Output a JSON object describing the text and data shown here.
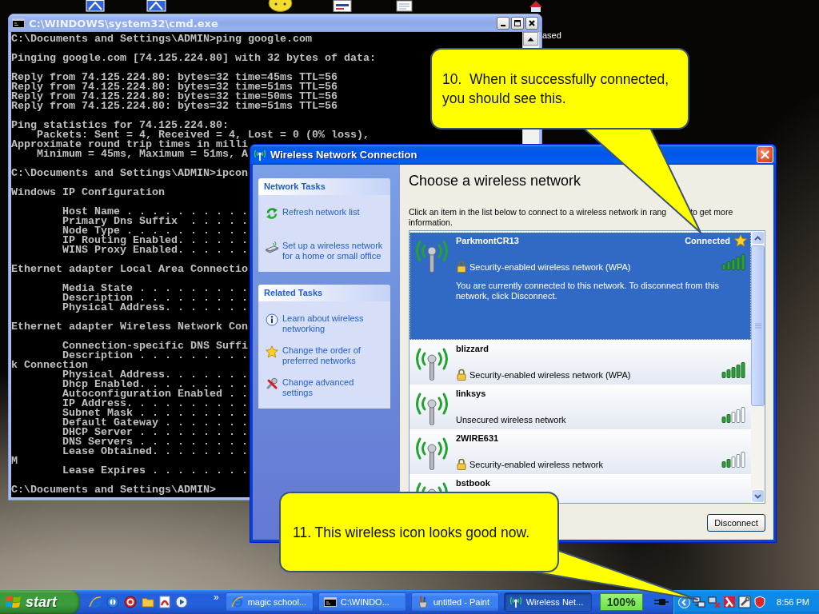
{
  "desktop": {
    "icon_label": "ased"
  },
  "cmd_window": {
    "title": "C:\\WINDOWS\\system32\\cmd.exe",
    "active": false,
    "blocks": [
      [
        "C:\\Documents and Settings\\ADMIN>ping google.com"
      ],
      [
        "Pinging google.com [74.125.224.80] with 32 bytes of data:"
      ],
      [
        "Reply from 74.125.224.80: bytes=32 time=45ms TTL=56",
        "Reply from 74.125.224.80: bytes=32 time=51ms TTL=56",
        "Reply from 74.125.224.80: bytes=32 time=50ms TTL=56",
        "Reply from 74.125.224.80: bytes=32 time=51ms TTL=56"
      ],
      [
        "Ping statistics for 74.125.224.80:",
        "    Packets: Sent = 4, Received = 4, Lost = 0 (0% loss),",
        "Approximate round trip times in milli",
        "    Minimum = 45ms, Maximum = 51ms, A"
      ],
      [
        "C:\\Documents and Settings\\ADMIN>ipcon"
      ],
      [
        "Windows IP Configuration"
      ],
      [
        "        Host Name . . . . . . . . . .",
        "        Primary Dns Suffix  . . . . .",
        "        Node Type . . . . . . . . . .",
        "        IP Routing Enabled. . . . . .",
        "        WINS Proxy Enabled. . . . . ."
      ],
      [
        "Ethernet adapter Local Area Connectio"
      ],
      [
        "        Media State . . . . . . . . .",
        "        Description . . . . . . . . .",
        "        Physical Address. . . . . . ."
      ],
      [
        "Ethernet adapter Wireless Network Con"
      ],
      [
        "        Connection-specific DNS Suffi",
        "        Description . . . . . . . . .",
        "k Connection",
        "        Physical Address. . . . . . .",
        "        Dhcp Enabled. . . . . . . . .",
        "        Autoconfiguration Enabled . .",
        "        IP Address. . . . . . . . . .",
        "        Subnet Mask . . . . . . . . .",
        "        Default Gateway . . . . . . .",
        "        DHCP Server . . . . . . . . .",
        "        DNS Servers . . . . . . . . .",
        "        Lease Obtained. . . . . . . .",
        "M",
        "        Lease Expires . . . . . . . ."
      ],
      [
        "C:\\Documents and Settings\\ADMIN>"
      ]
    ]
  },
  "wireless_dialog": {
    "title": "Wireless Network Connection",
    "active": true,
    "task_groups": [
      {
        "title": "Network Tasks",
        "items": [
          "Refresh network list",
          "Set up a wireless network for a home or small office"
        ]
      },
      {
        "title": "Related Tasks",
        "items": [
          "Learn about wireless networking",
          "Change the order of preferred networks",
          "Change advanced settings"
        ]
      }
    ],
    "heading": "Choose a wireless network",
    "instruction": "Click an item in the list below to connect to a wireless network in rang",
    "instruction_continued": "to get more information.",
    "networks": [
      {
        "name": "ParkmontCR13",
        "status": "Connected",
        "preferred": true,
        "secured": true,
        "security": "Security-enabled wireless network (WPA)",
        "description": "You are currently connected to this network. To disconnect from this network, click Disconnect.",
        "selected": true
      },
      {
        "name": "blizzard",
        "preferred": false,
        "secured": true,
        "security": "Security-enabled wireless network (WPA)",
        "selected": false
      },
      {
        "name": "linksys",
        "preferred": false,
        "secured": false,
        "security": "Unsecured wireless network",
        "selected": false
      },
      {
        "name": "2WIRE631",
        "preferred": false,
        "secured": true,
        "security": "Security-enabled wireless network",
        "selected": false
      },
      {
        "name": "bstbook",
        "preferred": false,
        "selected": false
      }
    ],
    "disconnect_button": "Disconnect"
  },
  "callouts": [
    {
      "text": "10.  When it successfully connected, you should see this."
    },
    {
      "text": "11. This wireless icon looks good now."
    }
  ],
  "taskbar": {
    "start_button": "start",
    "quick_launch_more": "»",
    "tasks": [
      {
        "label": "magic school...",
        "selected": false
      },
      {
        "label": "C:\\WINDO...",
        "selected": false
      },
      {
        "label": "untitled - Paint",
        "selected": false
      },
      {
        "label": "Wireless Net...",
        "selected": true
      }
    ],
    "indicator": "100%",
    "clock": "8:56 PM"
  }
}
